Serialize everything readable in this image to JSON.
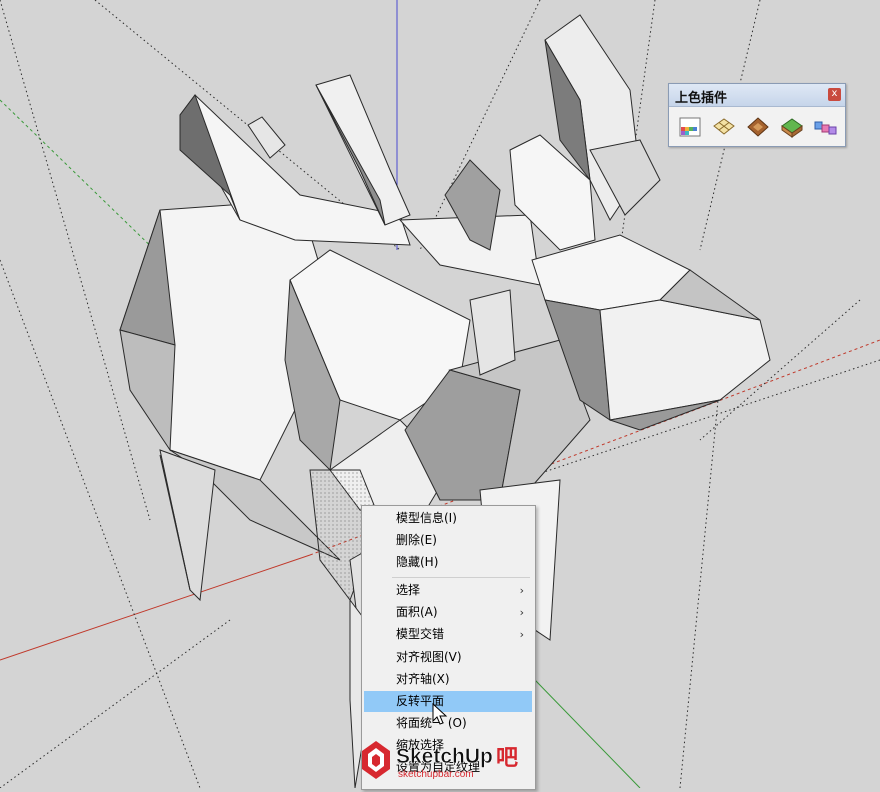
{
  "toolbar": {
    "title": "上色插件",
    "close_label": "x",
    "icons": [
      "color-grid-icon",
      "texture-grid-icon",
      "wood-material-icon",
      "terrain-icon",
      "color-cubes-icon"
    ]
  },
  "context_menu": {
    "items": [
      {
        "label": "模型信息(I)"
      },
      {
        "label": "删除(E)"
      },
      {
        "label": "隐藏(H)"
      },
      {
        "label": "选择",
        "submenu_arrow": "›"
      },
      {
        "label": "面积(A)",
        "submenu_arrow": "›"
      },
      {
        "label": "模型交错",
        "submenu_arrow": "›"
      },
      {
        "label": "对齐视图(V)"
      },
      {
        "label": "对齐轴(X)"
      },
      {
        "label": "反转平面"
      },
      {
        "label": "将面统一 (O)"
      },
      {
        "label": "缩放选择"
      },
      {
        "label": "设置为自定纹理"
      }
    ],
    "highlighted": "反转平面"
  },
  "watermark": {
    "brand": "SketchUp",
    "suffix": "吧",
    "site": "sketchupbar.com"
  },
  "colors": {
    "viewport_bg": "#d4d4d4",
    "menu_highlight": "#91c9f7",
    "axis_red": "#c0392b",
    "axis_green": "#3a9a3a",
    "axis_blue": "#4a4ad0",
    "watermark_red": "#d7282f"
  }
}
